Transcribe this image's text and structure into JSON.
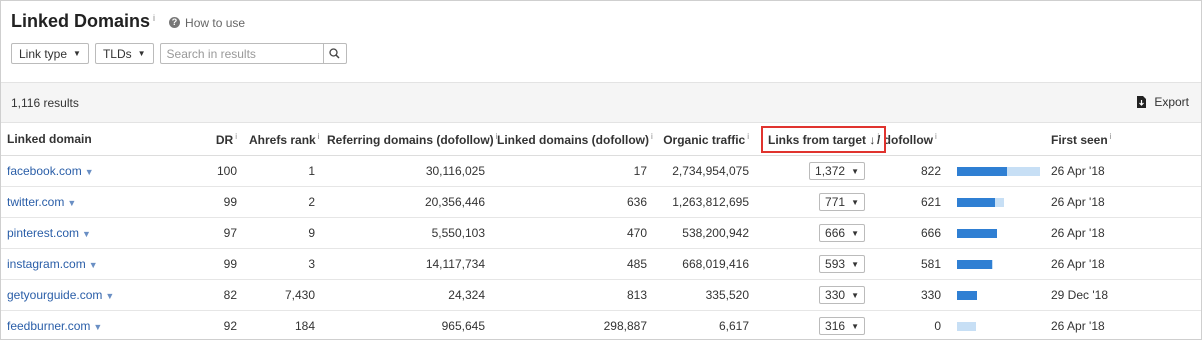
{
  "header": {
    "title": "Linked Domains",
    "title_info": "i",
    "how_to_use": "How to use"
  },
  "filters": {
    "link_type": "Link type",
    "tlds": "TLDs",
    "search_placeholder": "Search in results"
  },
  "results": {
    "count": "1,116 results",
    "export": "Export"
  },
  "table": {
    "columns": [
      {
        "label": "Linked domain",
        "info": ""
      },
      {
        "label": "DR",
        "info": "i"
      },
      {
        "label": "Ahrefs rank",
        "info": "i"
      },
      {
        "label": "Referring domains (dofollow)",
        "info": "i"
      },
      {
        "label": "Linked domains (dofollow)",
        "info": "i"
      },
      {
        "label": "Organic traffic",
        "info": "i"
      },
      {
        "label": "Links from target ↓",
        "info": "i"
      },
      {
        "label": "/ dofollow",
        "info": "i"
      },
      {
        "label": "",
        "info": ""
      },
      {
        "label": "First seen",
        "info": "i"
      }
    ],
    "rows": [
      {
        "domain": "facebook.com",
        "dr": "100",
        "rank": "1",
        "ref_domains": "30,116,025",
        "linked_domains": "17",
        "traffic": "2,734,954,075",
        "links": "1,372",
        "dofollow": "822",
        "first_seen": "26 Apr '18",
        "bar_dofollow": 0.6,
        "bar_total": 1.0
      },
      {
        "domain": "twitter.com",
        "dr": "99",
        "rank": "2",
        "ref_domains": "20,356,446",
        "linked_domains": "636",
        "traffic": "1,263,812,695",
        "links": "771",
        "dofollow": "621",
        "first_seen": "26 Apr '18",
        "bar_dofollow": 0.453,
        "bar_total": 0.562
      },
      {
        "domain": "pinterest.com",
        "dr": "97",
        "rank": "9",
        "ref_domains": "5,550,103",
        "linked_domains": "470",
        "traffic": "538,200,942",
        "links": "666",
        "dofollow": "666",
        "first_seen": "26 Apr '18",
        "bar_dofollow": 0.485,
        "bar_total": 0.485
      },
      {
        "domain": "instagram.com",
        "dr": "99",
        "rank": "3",
        "ref_domains": "14,117,734",
        "linked_domains": "485",
        "traffic": "668,019,416",
        "links": "593",
        "dofollow": "581",
        "first_seen": "26 Apr '18",
        "bar_dofollow": 0.424,
        "bar_total": 0.432
      },
      {
        "domain": "getyourguide.com",
        "dr": "82",
        "rank": "7,430",
        "ref_domains": "24,324",
        "linked_domains": "813",
        "traffic": "335,520",
        "links": "330",
        "dofollow": "330",
        "first_seen": "29 Dec '18",
        "bar_dofollow": 0.24,
        "bar_total": 0.24
      },
      {
        "domain": "feedburner.com",
        "dr": "92",
        "rank": "184",
        "ref_domains": "965,645",
        "linked_domains": "298,887",
        "traffic": "6,617",
        "links": "316",
        "dofollow": "0",
        "first_seen": "26 Apr '18",
        "bar_dofollow": 0.0,
        "bar_total": 0.23
      }
    ]
  },
  "colors": {
    "link": "#2a5ea8",
    "bar_dofollow": "#2f7fd3",
    "bar_total": "#c7dff5",
    "highlight_border": "#e0332e"
  }
}
